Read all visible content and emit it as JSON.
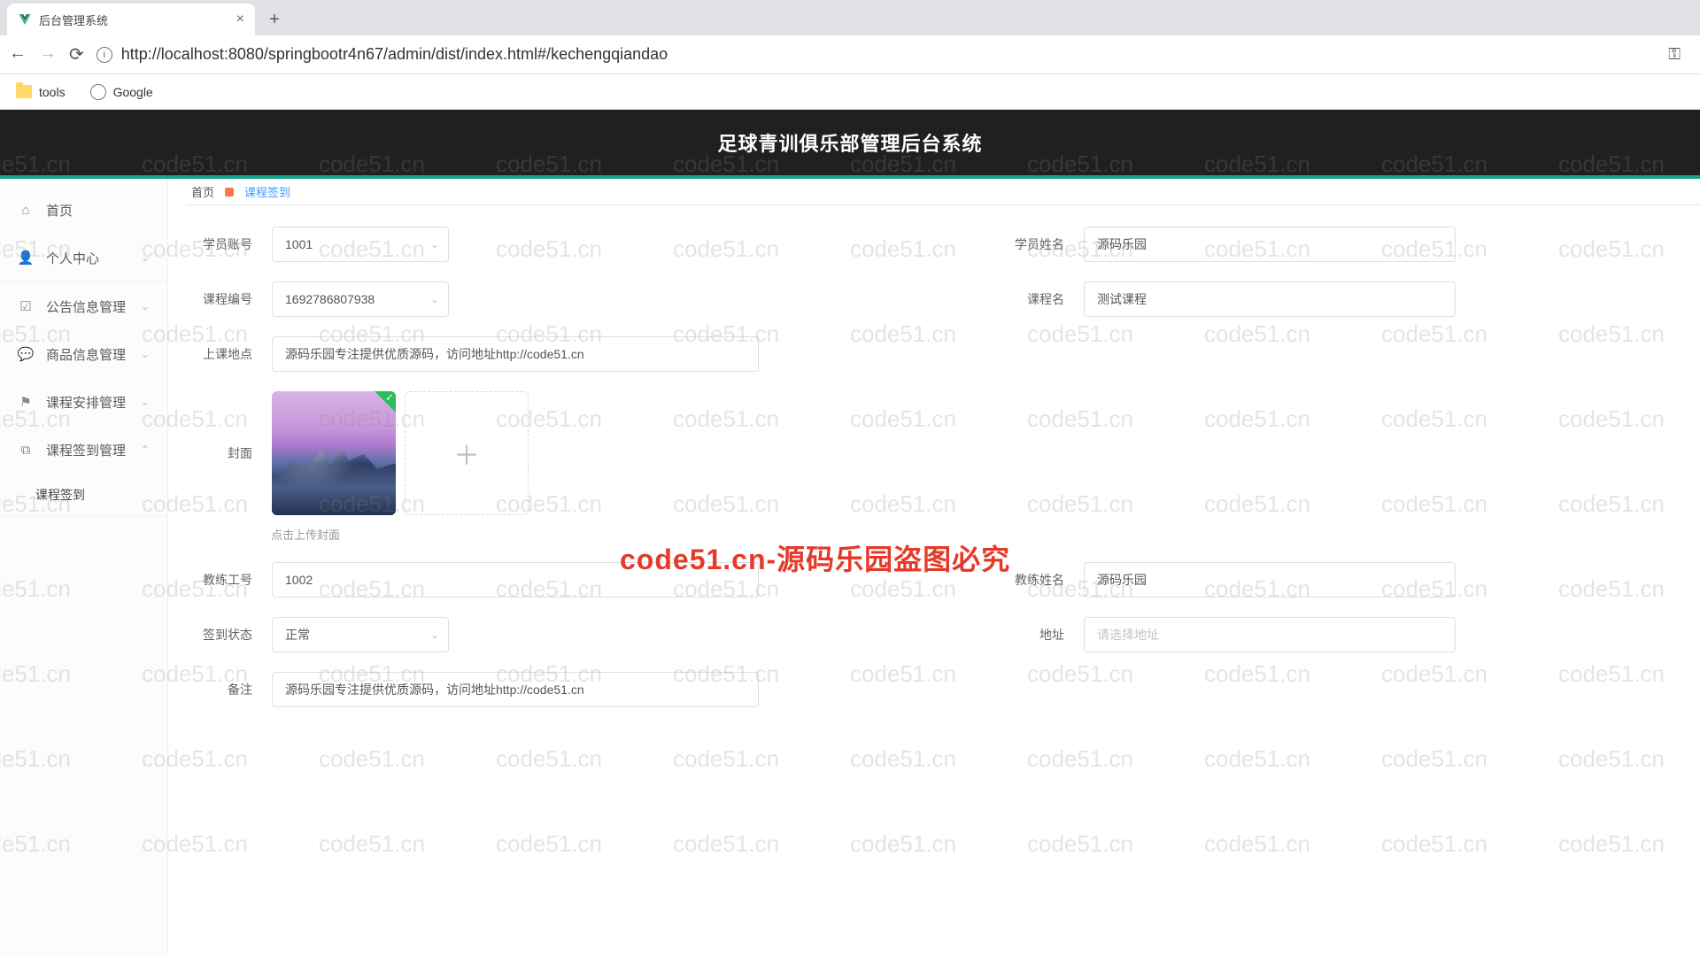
{
  "browser": {
    "tab_title": "后台管理系统",
    "url": "http://localhost:8080/springbootr4n67/admin/dist/index.html#/kechengqiandao",
    "bookmarks": {
      "folder": "tools",
      "google": "Google"
    }
  },
  "header": {
    "title": "足球青训俱乐部管理后台系统"
  },
  "sidebar": {
    "items": [
      {
        "label": "首页",
        "expandable": false
      },
      {
        "label": "个人中心",
        "expandable": true
      },
      {
        "label": "公告信息管理",
        "expandable": true
      },
      {
        "label": "商品信息管理",
        "expandable": true
      },
      {
        "label": "课程安排管理",
        "expandable": true
      },
      {
        "label": "课程签到管理",
        "expandable": true,
        "open": true
      }
    ],
    "sub": "课程签到"
  },
  "breadcrumb": {
    "home": "首页",
    "current": "课程签到"
  },
  "form": {
    "labels": {
      "student_account": "学员账号",
      "student_name": "学员姓名",
      "course_no": "课程编号",
      "course_name": "课程名",
      "location": "上课地点",
      "cover": "封面",
      "upload_hint": "点击上传封面",
      "coach_no": "教练工号",
      "coach_name": "教练姓名",
      "sign_status": "签到状态",
      "address": "地址",
      "remark": "备注"
    },
    "values": {
      "student_account": "1001",
      "student_name": "源码乐园",
      "course_no": "1692786807938",
      "course_name": "测试课程",
      "location": "源码乐园专注提供优质源码，访问地址http://code51.cn",
      "coach_no": "1002",
      "coach_name": "源码乐园",
      "sign_status": "正常",
      "address_placeholder": "请选择地址",
      "remark": "源码乐园专注提供优质源码，访问地址http://code51.cn"
    }
  },
  "watermark": {
    "overlay": "code51.cn-源码乐园盗图必究",
    "bg": "code51.cn"
  }
}
